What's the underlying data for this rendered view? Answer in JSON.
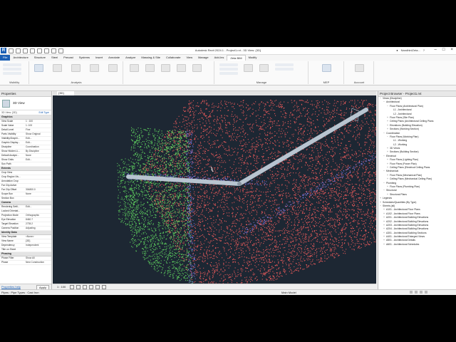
{
  "window": {
    "title": "Autodesk Revit 2024.1 - Project1.rvt - 3D View: {3D}",
    "user": "NandhiniZeta..."
  },
  "ribbon": {
    "tabs": [
      {
        "label": "File"
      },
      {
        "label": "Architecture"
      },
      {
        "label": "Structure"
      },
      {
        "label": "Steel"
      },
      {
        "label": "Precast"
      },
      {
        "label": "Systems"
      },
      {
        "label": "Insert"
      },
      {
        "label": "Annotate"
      },
      {
        "label": "Analyze"
      },
      {
        "label": "Massing & Site"
      },
      {
        "label": "Collaborate"
      },
      {
        "label": "View"
      },
      {
        "label": "Manage"
      },
      {
        "label": "Add-Ins"
      },
      {
        "label": "Zeta BIM"
      },
      {
        "label": "Modify"
      }
    ],
    "panels": {
      "visibility": "Visibility",
      "analysis": "Analysis",
      "manage": "Manage",
      "mep": "MEP",
      "account": "Account"
    }
  },
  "properties": {
    "header": "Properties",
    "type_name": "3D View",
    "instance_label": "3D View: {3D}",
    "edit_type": "Edit Type",
    "groups": [
      {
        "name": "Graphics",
        "rows": [
          {
            "name": "View Scale",
            "value": "1 : 100"
          },
          {
            "name": "Scale Value",
            "value": "1: 100"
          },
          {
            "name": "Detail Level",
            "value": "Fine"
          },
          {
            "name": "Parts Visibility",
            "value": "Show Original"
          },
          {
            "name": "Visibility/Graphi...",
            "value": "Edit..."
          },
          {
            "name": "Graphic Display...",
            "value": "Edit..."
          },
          {
            "name": "Discipline",
            "value": "Coordination"
          },
          {
            "name": "Show Hidden Li...",
            "value": "By Discipline"
          },
          {
            "name": "Default Analysi...",
            "value": "None"
          },
          {
            "name": "Show Grids",
            "value": "Edit..."
          },
          {
            "name": "Sun Path",
            "value": ""
          }
        ]
      },
      {
        "name": "Extents",
        "rows": [
          {
            "name": "Crop View",
            "value": ""
          },
          {
            "name": "Crop Region Vis...",
            "value": ""
          },
          {
            "name": "Annotation Crop",
            "value": ""
          },
          {
            "name": "Far Clip Active",
            "value": ""
          },
          {
            "name": "Far Clip Offset",
            "value": "304800.0"
          },
          {
            "name": "Scope Box",
            "value": "None"
          },
          {
            "name": "Section Box",
            "value": ""
          }
        ]
      },
      {
        "name": "Camera",
        "rows": [
          {
            "name": "Rendering Setti...",
            "value": "Edit..."
          },
          {
            "name": "Locked Orientat...",
            "value": ""
          },
          {
            "name": "Projection Mode",
            "value": "Orthographic"
          },
          {
            "name": "Eye Elevation",
            "value": "8460.7"
          },
          {
            "name": "Target Elevation",
            "value": "2735.2"
          },
          {
            "name": "Camera Position",
            "value": "Adjusting"
          }
        ]
      },
      {
        "name": "Identity Data",
        "rows": [
          {
            "name": "View Template",
            "value": "<None>"
          },
          {
            "name": "View Name",
            "value": "{3D}"
          },
          {
            "name": "Dependency",
            "value": "Independent"
          },
          {
            "name": "Title on Sheet",
            "value": ""
          }
        ]
      },
      {
        "name": "Phasing",
        "rows": [
          {
            "name": "Phase Filter",
            "value": "Show All"
          },
          {
            "name": "Phase",
            "value": "New Construction"
          }
        ]
      }
    ],
    "help_link": "Properties help",
    "apply": "Apply"
  },
  "view": {
    "tab": "{3D}",
    "scale": "1 : 100"
  },
  "browser": {
    "header": "Project Browser - Project1.rvt",
    "items": [
      {
        "depth": 0,
        "toggle": "−",
        "label": "Views (Discipline)"
      },
      {
        "depth": 1,
        "toggle": "−",
        "label": "Architectural"
      },
      {
        "depth": 2,
        "toggle": "−",
        "label": "Floor Plans (Architectural Plan)"
      },
      {
        "depth": 3,
        "toggle": "",
        "label": "L1 - Architectural"
      },
      {
        "depth": 3,
        "toggle": "",
        "label": "L2 - Architectural"
      },
      {
        "depth": 2,
        "toggle": "+",
        "label": "Floor Plans (Site Plan)"
      },
      {
        "depth": 2,
        "toggle": "+",
        "label": "Ceiling Plans (Architectural Ceiling Plans"
      },
      {
        "depth": 2,
        "toggle": "+",
        "label": "Elevations (Building Elevation)"
      },
      {
        "depth": 2,
        "toggle": "+",
        "label": "Sections (Working Section)"
      },
      {
        "depth": 1,
        "toggle": "−",
        "label": "Coordination"
      },
      {
        "depth": 2,
        "toggle": "−",
        "label": "Floor Plans (Working Plan)"
      },
      {
        "depth": 3,
        "toggle": "",
        "label": "L1 - Working"
      },
      {
        "depth": 3,
        "toggle": "",
        "label": "L2 - Working"
      },
      {
        "depth": 2,
        "toggle": "+",
        "label": "3D Views"
      },
      {
        "depth": 2,
        "toggle": "+",
        "label": "Sections (Building Section)"
      },
      {
        "depth": 1,
        "toggle": "−",
        "label": "Electrical"
      },
      {
        "depth": 2,
        "toggle": "+",
        "label": "Floor Plans (Lighting Plan)"
      },
      {
        "depth": 2,
        "toggle": "+",
        "label": "Floor Plans (Power Plan)"
      },
      {
        "depth": 2,
        "toggle": "+",
        "label": "Ceiling Plans (Electrical Ceiling Plans"
      },
      {
        "depth": 1,
        "toggle": "−",
        "label": "Mechanical"
      },
      {
        "depth": 2,
        "toggle": "+",
        "label": "Floor Plans (Mechanical Plan)"
      },
      {
        "depth": 2,
        "toggle": "+",
        "label": "Ceiling Plans (Mechanical Ceiling Plan)"
      },
      {
        "depth": 1,
        "toggle": "−",
        "label": "Plumbing"
      },
      {
        "depth": 2,
        "toggle": "+",
        "label": "Floor Plans (Plumbing Plan)"
      },
      {
        "depth": 1,
        "toggle": "−",
        "label": "Structural"
      },
      {
        "depth": 2,
        "toggle": "+",
        "label": "Structural Plans"
      },
      {
        "depth": 0,
        "toggle": "+",
        "label": "Legends"
      },
      {
        "depth": 0,
        "toggle": "+",
        "label": "Schedules/Quantities (By Type)"
      },
      {
        "depth": 0,
        "toggle": "−",
        "label": "Sheets (all)"
      },
      {
        "depth": 1,
        "toggle": "+",
        "label": "A101 - Architectural Floor Plans"
      },
      {
        "depth": 1,
        "toggle": "+",
        "label": "A102 - Architectural Floor Plans"
      },
      {
        "depth": 1,
        "toggle": "+",
        "label": "A201 - Architectural Building Elevations"
      },
      {
        "depth": 1,
        "toggle": "+",
        "label": "A202 - Architectural Building Elevations"
      },
      {
        "depth": 1,
        "toggle": "+",
        "label": "A203 - Architectural Building Elevations"
      },
      {
        "depth": 1,
        "toggle": "+",
        "label": "A204 - Architectural Building Elevations"
      },
      {
        "depth": 1,
        "toggle": "+",
        "label": "A301 - Architectural Building Sections"
      },
      {
        "depth": 1,
        "toggle": "+",
        "label": "A401 - Architectural Enlarged Views"
      },
      {
        "depth": 1,
        "toggle": "+",
        "label": "A501 - Architectural Details"
      },
      {
        "depth": 1,
        "toggle": "+",
        "label": "A601 - Architectural Schedules"
      }
    ]
  },
  "status": {
    "message": "Pipes : Pipe Types : Cast Iron",
    "model": "Main Model"
  },
  "colors": {
    "point_red": "#e85a5a",
    "point_green": "#5fd35f",
    "point_blue": "#7a7ae8",
    "background": "#1d2733",
    "pipe": "#b8c4d0"
  }
}
